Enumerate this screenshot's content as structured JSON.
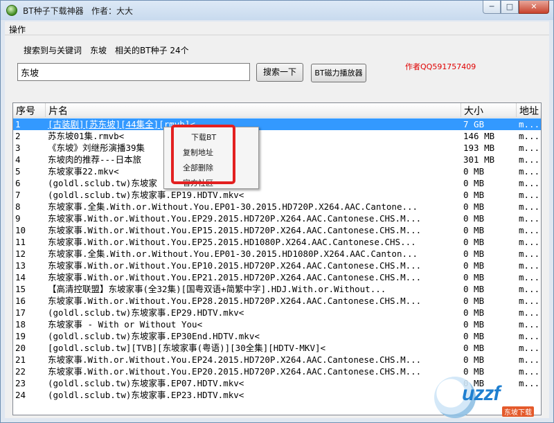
{
  "window": {
    "title": "BT种子下载神器   作者：大大",
    "controls": {
      "minimize": "─",
      "maximize": "□",
      "close": "✕"
    }
  },
  "menu": {
    "operate": "操作"
  },
  "search": {
    "summary_prefix": "搜索到与关键词",
    "keyword": "东坡",
    "summary_suffix": "相关的BT种子 24个",
    "input_value": "东坡",
    "search_button": "搜索一下",
    "player_button": "BT磁力播放器",
    "author_note": "作者QQ591757409"
  },
  "list": {
    "columns": [
      "序号",
      "片名",
      "大小",
      "地址"
    ],
    "selected_index": 0,
    "rows": [
      {
        "no": "1",
        "name": "[古装剧][苏东坡][44集全][rmvb]<",
        "size": "7 GB",
        "addr": "m..."
      },
      {
        "no": "2",
        "name": "苏东坡01集.rmvb<",
        "size": "146 MB",
        "addr": "m..."
      },
      {
        "no": "3",
        "name": "《东坡》刘继彤演播39集",
        "size": "193 MB",
        "addr": "m..."
      },
      {
        "no": "4",
        "name": "东坡肉的推荐---日本旅",
        "size": "301 MB",
        "addr": "m..."
      },
      {
        "no": "5",
        "name": "东坡家事22.mkv<",
        "size": "0 MB",
        "addr": "m..."
      },
      {
        "no": "6",
        "name": "(goldl.sclub.tw)东坡家",
        "size": "0 MB",
        "addr": "m..."
      },
      {
        "no": "7",
        "name": "(goldl.sclub.tw)东坡家事.EP19.HDTV.mkv<",
        "size": "0 MB",
        "addr": "m..."
      },
      {
        "no": "8",
        "name": "东坡家事.全集.With.or.Without.You.EP01-30.2015.HD720P.X264.AAC.Cantone...",
        "size": "0 MB",
        "addr": "m..."
      },
      {
        "no": "9",
        "name": "东坡家事.With.or.Without.You.EP29.2015.HD720P.X264.AAC.Cantonese.CHS.M...",
        "size": "0 MB",
        "addr": "m..."
      },
      {
        "no": "10",
        "name": "东坡家事.With.or.Without.You.EP15.2015.HD720P.X264.AAC.Cantonese.CHS.M...",
        "size": "0 MB",
        "addr": "m..."
      },
      {
        "no": "11",
        "name": "东坡家事.With.or.Without.You.EP25.2015.HD1080P.X264.AAC.Cantonese.CHS...",
        "size": "0 MB",
        "addr": "m..."
      },
      {
        "no": "12",
        "name": "东坡家事.全集.With.or.Without.You.EP01-30.2015.HD1080P.X264.AAC.Canton...",
        "size": "0 MB",
        "addr": "m..."
      },
      {
        "no": "13",
        "name": "东坡家事.With.or.Without.You.EP10.2015.HD720P.X264.AAC.Cantonese.CHS.M...",
        "size": "0 MB",
        "addr": "m..."
      },
      {
        "no": "14",
        "name": "东坡家事.With.or.Without.You.EP21.2015.HD720P.X264.AAC.Cantonese.CHS.M...",
        "size": "0 MB",
        "addr": "m..."
      },
      {
        "no": "15",
        "name": "【高清控联盟】东坡家事(全32集)[国粤双语+简繁中字].HDJ.With.or.Without...",
        "size": "0 MB",
        "addr": "m..."
      },
      {
        "no": "16",
        "name": "东坡家事.With.or.Without.You.EP28.2015.HD720P.X264.AAC.Cantonese.CHS.M...",
        "size": "0 MB",
        "addr": "m..."
      },
      {
        "no": "17",
        "name": "(goldl.sclub.tw)东坡家事.EP29.HDTV.mkv<",
        "size": "0 MB",
        "addr": "m..."
      },
      {
        "no": "18",
        "name": "东坡家事 - With or Without You<",
        "size": "0 MB",
        "addr": "m..."
      },
      {
        "no": "19",
        "name": "(goldl.sclub.tw)东坡家事.EP30End.HDTV.mkv<",
        "size": "0 MB",
        "addr": "m..."
      },
      {
        "no": "20",
        "name": "[goldl.sclub.tw][TVB][东坡家事(粤语)][30全集][HDTV-MKV]<",
        "size": "0 MB",
        "addr": "m..."
      },
      {
        "no": "21",
        "name": "东坡家事.With.or.Without.You.EP24.2015.HD720P.X264.AAC.Cantonese.CHS.M...",
        "size": "0 MB",
        "addr": "m..."
      },
      {
        "no": "22",
        "name": "东坡家事.With.or.Without.You.EP20.2015.HD720P.X264.AAC.Cantonese.CHS.M...",
        "size": "0 MB",
        "addr": "m..."
      },
      {
        "no": "23",
        "name": "(goldl.sclub.tw)东坡家事.EP07.HDTV.mkv<",
        "size": "0 MB",
        "addr": "m..."
      },
      {
        "no": "24",
        "name": "(goldl.sclub.tw)东坡家事.EP23.HDTV.mkv<",
        "size": "",
        "addr": ""
      }
    ]
  },
  "context_menu": {
    "items": [
      "下载BT",
      "复制地址",
      "全部删除",
      "官方社区"
    ]
  },
  "watermark": {
    "brand": "uzzf",
    "sub": "东坡下载"
  },
  "colors": {
    "selection": "#3399ff",
    "author_note": "#e00000",
    "highlight_box": "#e32020"
  }
}
